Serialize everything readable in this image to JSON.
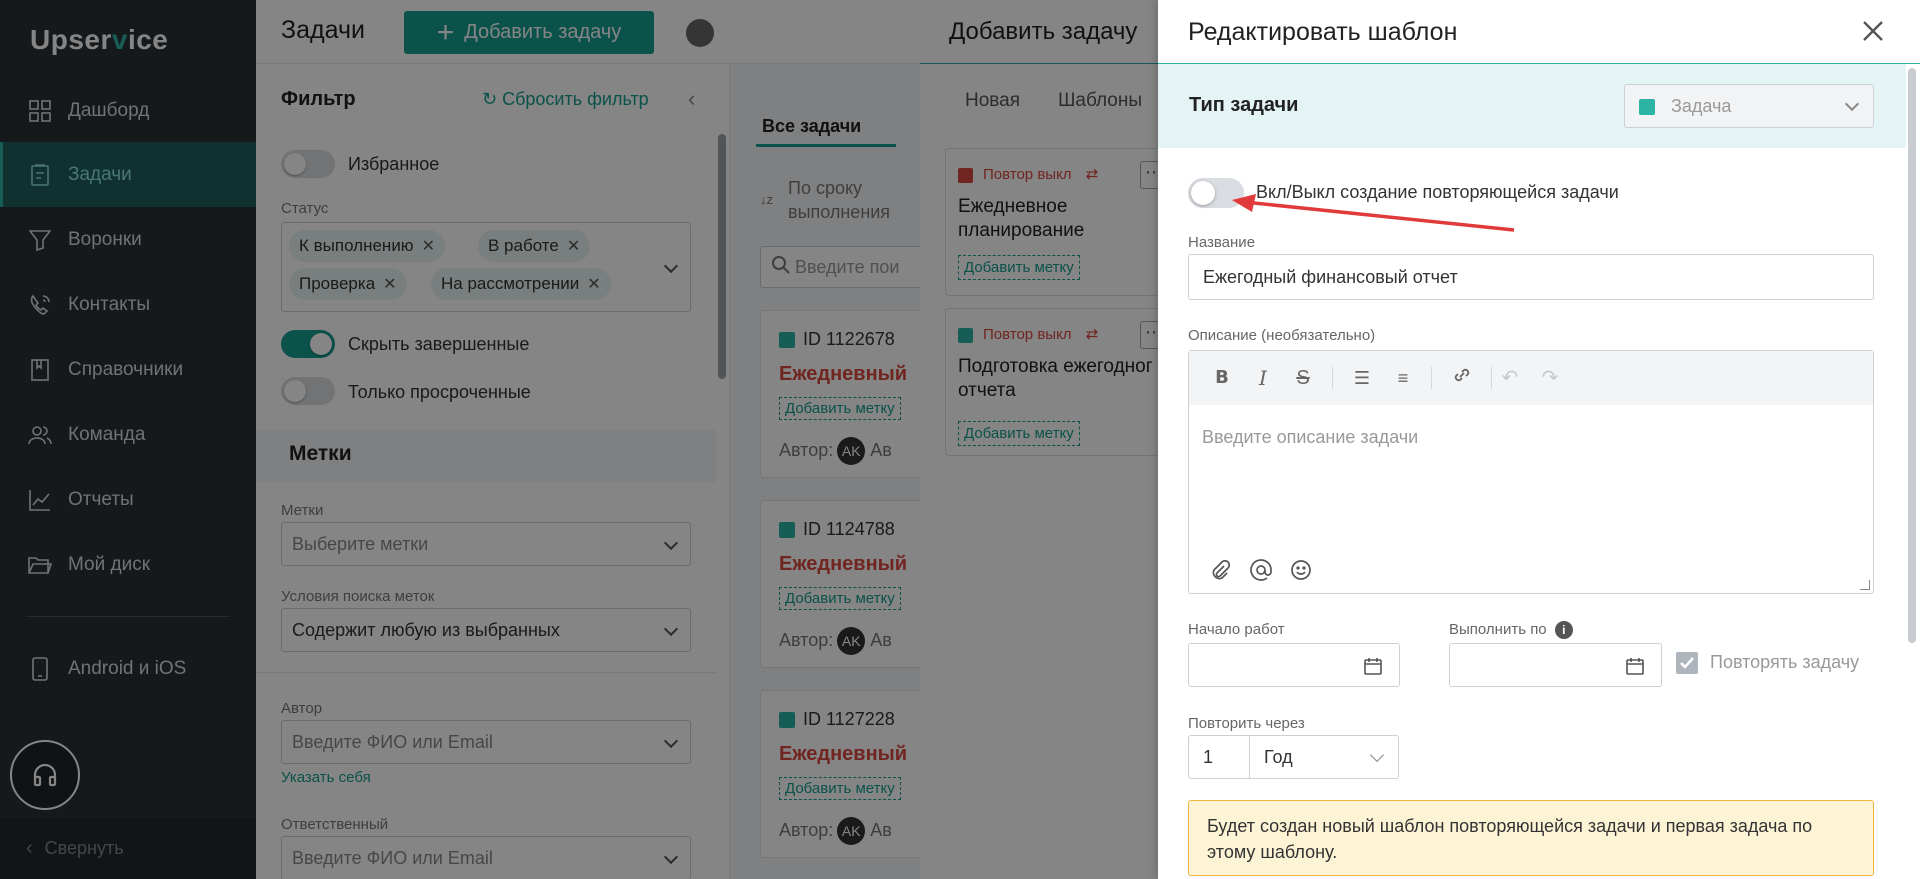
{
  "sidebar": {
    "logo": {
      "pre": "Upser",
      "v": "v",
      "post": "ice"
    },
    "items": [
      {
        "label": "Дашборд",
        "icon": "dashboard-icon"
      },
      {
        "label": "Задачи",
        "icon": "tasks-icon",
        "active": true
      },
      {
        "label": "Воронки",
        "icon": "funnel-icon"
      },
      {
        "label": "Контакты",
        "icon": "contacts-icon"
      },
      {
        "label": "Справочники",
        "icon": "book-icon"
      },
      {
        "label": "Команда",
        "icon": "team-icon"
      },
      {
        "label": "Отчеты",
        "icon": "reports-icon"
      },
      {
        "label": "Мой диск",
        "icon": "folder-icon"
      },
      {
        "label": "Android и iOS",
        "icon": "phone-icon"
      }
    ],
    "collapse_label": "Свернуть"
  },
  "header": {
    "title": "Задачи",
    "add_label": "Добавить задачу"
  },
  "filter": {
    "title": "Фильтр",
    "reset_label": "Сбросить фильтр",
    "favorites_label": "Избранное",
    "status_label": "Статус",
    "status_chips": [
      "К выполнению",
      "В работе",
      "Проверка",
      "На рассмотрении"
    ],
    "hide_done_label": "Скрыть завершенные",
    "overdue_label": "Только просроченные",
    "tags_section": "Метки",
    "tags_label": "Метки",
    "tags_placeholder": "Выберите метки",
    "search_cond_label": "Условия поиска меток",
    "search_cond_value": "Содержит любую из выбранных",
    "author_label": "Автор",
    "author_placeholder": "Введите ФИО или Email",
    "self_link": "Указать себя",
    "responsible_label": "Ответственный",
    "responsible_placeholder": "Введите ФИО или Email"
  },
  "tasks": {
    "tab_all": "Все задачи",
    "sort_label": "По сроку выполнения",
    "search_placeholder": "Введите пои",
    "cards": [
      {
        "id": "ID 1122678",
        "name": "Ежедневный",
        "tag": "Добавить метку",
        "author": "Автор:",
        "avatar": "AK",
        "author_name": "Ав"
      },
      {
        "id": "ID 1124788",
        "name": "Ежедневный",
        "tag": "Добавить метку",
        "author": "Автор:",
        "avatar": "AK",
        "author_name": "Ав"
      },
      {
        "id": "ID 1127228",
        "name": "Ежедневный",
        "tag": "Добавить метку",
        "author": "Автор:",
        "avatar": "AK",
        "author_name": "Ав"
      }
    ]
  },
  "add_drawer": {
    "title": "Добавить задачу",
    "tabs": [
      "Новая",
      "Шаблоны"
    ],
    "templates": [
      {
        "badge": "Повтор выкл",
        "title": "Ежедневное планирование",
        "tag": "Добавить метку"
      },
      {
        "badge": "Повтор выкл",
        "title": "Подготовка ежегодног отчета",
        "tag": "Добавить метку"
      }
    ]
  },
  "edit_drawer": {
    "title": "Редактировать шаблон",
    "type_label": "Тип задачи",
    "type_value": "Задача",
    "repeat_toggle_label": "Вкл/Выкл создание повторяющейся задачи",
    "name_label": "Название",
    "name_value": "Ежегодный финансовый отчет",
    "desc_label": "Описание (необязательно)",
    "desc_placeholder": "Введите описание задачи",
    "start_label": "Начало работ",
    "due_label": "Выполнить по",
    "repeat_checkbox_label": "Повторять задачу",
    "repeat_every_label": "Повторить через",
    "repeat_every_value": "1",
    "repeat_unit": "Год",
    "notice": "Будет создан новый шаблон повторяющейся задачи и первая задача по этому шаблону."
  },
  "colors": {
    "accent": "#169d8e",
    "sidebar_bg": "#2a3137",
    "danger": "#d8473f",
    "notice_bg": "#fdf4d6"
  }
}
